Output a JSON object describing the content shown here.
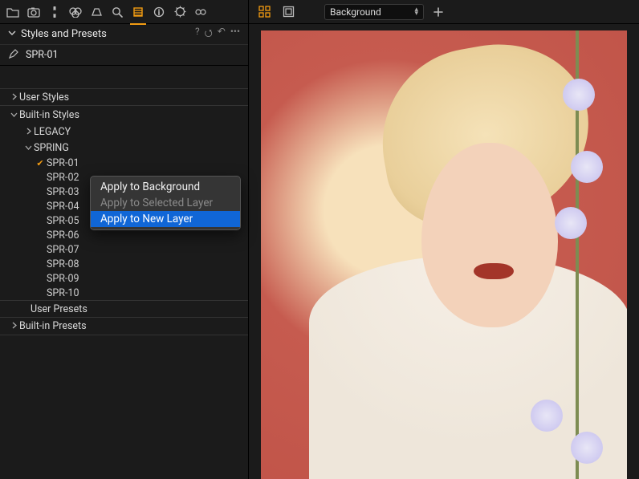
{
  "panel": {
    "title": "Styles and Presets",
    "actions": {
      "help": "?",
      "revert": "⭯",
      "undo": "↶",
      "more": "•••"
    }
  },
  "current_style": "SPR-01",
  "tree": {
    "user_styles": {
      "label": "User Styles"
    },
    "builtin_styles": {
      "label": "Built-in Styles",
      "legacy": {
        "label": "LEGACY"
      },
      "spring": {
        "label": "SPRING",
        "items": [
          {
            "label": "SPR-01",
            "checked": true
          },
          {
            "label": "SPR-02",
            "checked": false
          },
          {
            "label": "SPR-03",
            "checked": false
          },
          {
            "label": "SPR-04",
            "checked": false
          },
          {
            "label": "SPR-05",
            "checked": false
          },
          {
            "label": "SPR-06",
            "checked": false
          },
          {
            "label": "SPR-07",
            "checked": false
          },
          {
            "label": "SPR-08",
            "checked": false
          },
          {
            "label": "SPR-09",
            "checked": false
          },
          {
            "label": "SPR-10",
            "checked": false
          }
        ]
      }
    },
    "user_presets": {
      "label": "User Presets"
    },
    "builtin_presets": {
      "label": "Built-in Presets"
    }
  },
  "context_menu": {
    "items": [
      {
        "label": "Apply to Background",
        "state": "normal"
      },
      {
        "label": "Apply to Selected Layer",
        "state": "disabled"
      },
      {
        "label": "Apply to New Layer",
        "state": "highlight"
      }
    ]
  },
  "main_toolbar": {
    "layer_selected": "Background"
  }
}
